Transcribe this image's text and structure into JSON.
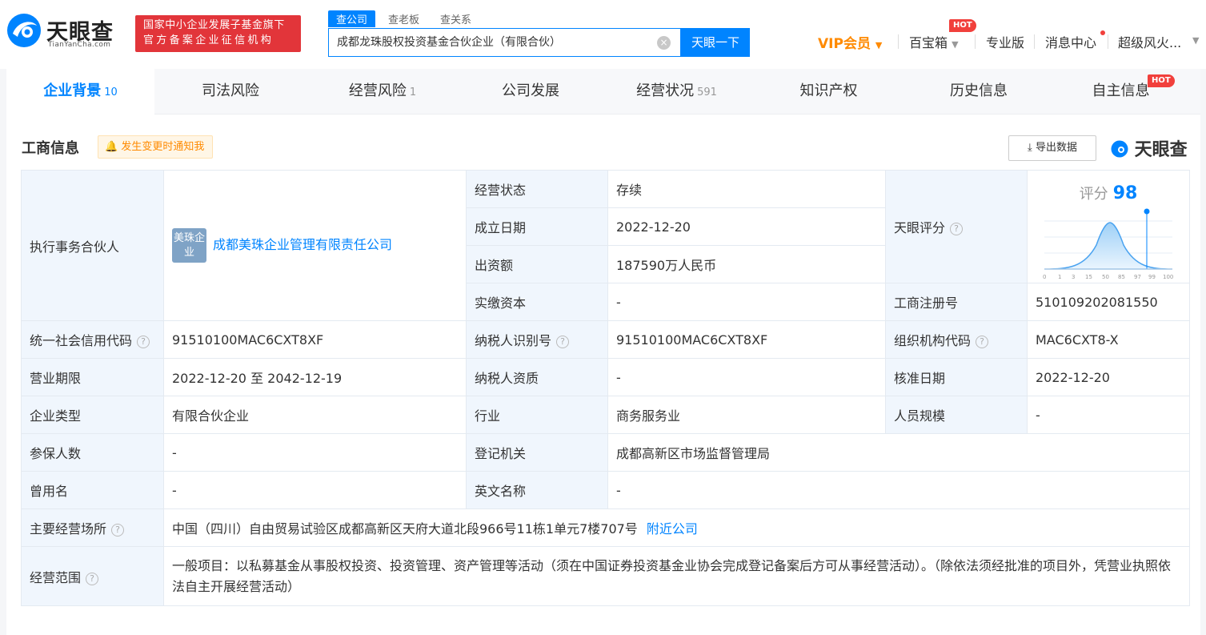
{
  "header": {
    "logo_text": "天眼查",
    "logo_sub": "TianYanCha.com",
    "badge_line1": "国家中小企业发展子基金旗下",
    "badge_line2": "官方备案企业征信机构",
    "search_tabs": [
      "查公司",
      "查老板",
      "查关系"
    ],
    "search_value": "成都龙珠股权投资基金合伙企业（有限合伙）",
    "search_button": "天眼一下",
    "vip_label": "VIP会员",
    "nav": {
      "baobao": "百宝箱",
      "pro": "专业版",
      "msg": "消息中心",
      "user": "超级风火..."
    },
    "hot": "HOT"
  },
  "tabs": [
    {
      "label": "企业背景",
      "count": "10"
    },
    {
      "label": "司法风险",
      "count": ""
    },
    {
      "label": "经营风险",
      "count": "1"
    },
    {
      "label": "公司发展",
      "count": ""
    },
    {
      "label": "经营状况",
      "count": "591"
    },
    {
      "label": "知识产权",
      "count": ""
    },
    {
      "label": "历史信息",
      "count": ""
    },
    {
      "label": "自主信息",
      "count": ""
    }
  ],
  "section": {
    "title": "工商信息",
    "notify": "发生变更时通知我",
    "export": "导出数据",
    "brand": "天眼查"
  },
  "info": {
    "partner_label": "执行事务合伙人",
    "partner_logo": "美珠企业",
    "partner_name": "成都美珠企业管理有限责任公司",
    "status_label": "经营状态",
    "status": "存续",
    "founded_label": "成立日期",
    "founded": "2022-12-20",
    "capital_label": "出资额",
    "capital": "187590万人民币",
    "paid_label": "实缴资本",
    "paid": "-",
    "score_row_label": "天眼评分",
    "score_label": "评分",
    "score": "98",
    "score_ticks": [
      "0",
      "1",
      "3",
      "15",
      "50",
      "85",
      "97",
      "99",
      "100"
    ],
    "reg_no_label": "工商注册号",
    "reg_no": "510109202081550",
    "credit_label": "统一社会信用代码",
    "credit": "91510100MAC6CXT8XF",
    "taxid_label": "纳税人识别号",
    "taxid": "91510100MAC6CXT8XF",
    "orgcode_label": "组织机构代码",
    "orgcode": "MAC6CXT8-X",
    "term_label": "营业期限",
    "term": "2022-12-20 至 2042-12-19",
    "taxq_label": "纳税人资质",
    "taxq": "-",
    "approve_label": "核准日期",
    "approve": "2022-12-20",
    "type_label": "企业类型",
    "type": "有限合伙企业",
    "industry_label": "行业",
    "industry": "商务服务业",
    "staff_label": "人员规模",
    "staff": "-",
    "insured_label": "参保人数",
    "insured": "-",
    "authority_label": "登记机关",
    "authority": "成都高新区市场监督管理局",
    "former_label": "曾用名",
    "former": "-",
    "en_label": "英文名称",
    "en": "-",
    "addr_label": "主要经营场所",
    "addr": "中国（四川）自由贸易试验区成都高新区天府大道北段966号11栋1单元7楼707号",
    "nearby": "附近公司",
    "scope_label": "经营范围",
    "scope": "一般项目：以私募基金从事股权投资、投资管理、资产管理等活动（须在中国证券投资基金业协会完成登记备案后方可从事经营活动）。（除依法须经批准的项目外，凭营业执照依法自主开展经营活动）"
  },
  "colors": {
    "accent": "#0084ff",
    "badge": "#e2353a",
    "vip": "#ff8a00",
    "key_bg": "#f0f6fd"
  }
}
